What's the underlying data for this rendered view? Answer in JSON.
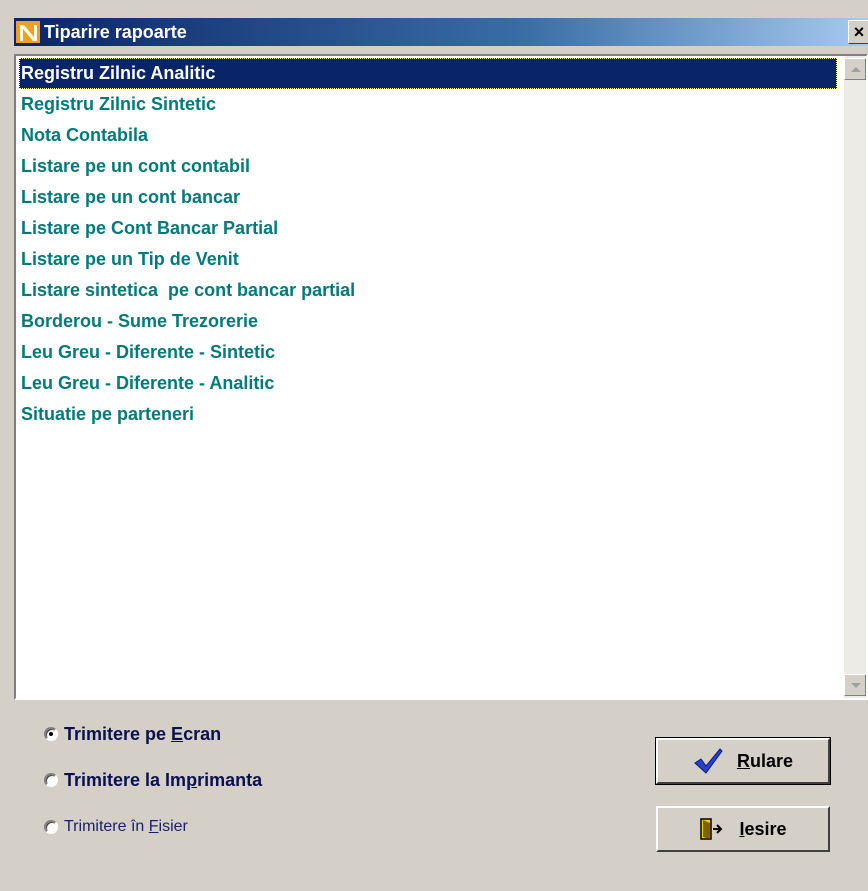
{
  "window": {
    "title": "Tiparire rapoarte",
    "close_glyph": "×"
  },
  "reports": {
    "selected_index": 0,
    "items": [
      "Registru Zilnic Analitic",
      "Registru Zilnic Sintetic",
      "Nota Contabila",
      "Listare pe un cont contabil",
      "Listare pe un cont bancar",
      "Listare pe Cont Bancar Partial",
      "Listare pe un Tip de Venit",
      "Listare sintetica  pe cont bancar partial",
      "Borderou - Sume Trezorerie",
      "Leu Greu - Diferente - Sintetic",
      "Leu Greu - Diferente - Analitic",
      "Situatie pe parteneri"
    ]
  },
  "output_options": {
    "screen": {
      "pre": "Trimitere pe ",
      "key": "E",
      "post": "cran",
      "checked": true
    },
    "printer": {
      "pre": "Trimitere la Im",
      "key": "p",
      "post": "rimanta",
      "checked": false
    },
    "file": {
      "pre": "Trimitere în ",
      "key": "F",
      "post": "isier",
      "checked": false
    }
  },
  "buttons": {
    "run": {
      "key": "R",
      "rest": "ulare",
      "icon": "checkmark-icon"
    },
    "exit": {
      "key": "I",
      "rest": "esire",
      "icon": "exit-door-icon"
    }
  },
  "colors": {
    "list_text": "#007a7a",
    "selection": "#0a246a",
    "titlebar": "#0a246a"
  }
}
